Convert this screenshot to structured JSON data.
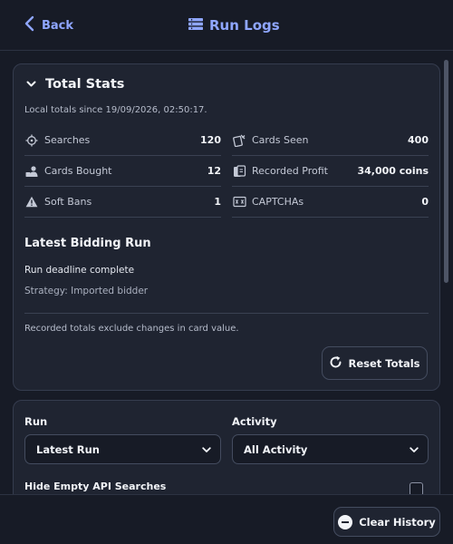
{
  "header": {
    "back_label": "Back",
    "title": "Run Logs"
  },
  "total_stats": {
    "heading": "Total Stats",
    "since_note": "Local totals since 19/09/2026, 02:50:17.",
    "stats": [
      {
        "label": "Searches",
        "value": "120",
        "icon": "crosshair-icon"
      },
      {
        "label": "Cards Seen",
        "value": "400",
        "icon": "card-eye-icon"
      },
      {
        "label": "Cards Bought",
        "value": "12",
        "icon": "user-card-icon"
      },
      {
        "label": "Recorded Profit",
        "value": "34,000 coins",
        "icon": "coins-icon"
      },
      {
        "label": "Soft Bans",
        "value": "1",
        "icon": "warning-icon"
      },
      {
        "label": "CAPTCHAs",
        "value": "0",
        "icon": "captcha-icon"
      }
    ],
    "latest_run_heading": "Latest Bidding Run",
    "run_status": "Run deadline complete",
    "strategy": "Strategy: Imported bidder",
    "footnote": "Recorded totals exclude changes in card value.",
    "reset_label": "Reset Totals"
  },
  "filters": {
    "run_label": "Run",
    "run_selected": "Latest Run",
    "activity_label": "Activity",
    "activity_selected": "All Activity",
    "hide_empty_label": "Hide Empty API Searches",
    "hide_empty_checked": false
  },
  "footer": {
    "clear_label": "Clear History"
  },
  "colors": {
    "accent": "#8fa6ff",
    "background": "#171b26",
    "card": "#1f2431"
  }
}
